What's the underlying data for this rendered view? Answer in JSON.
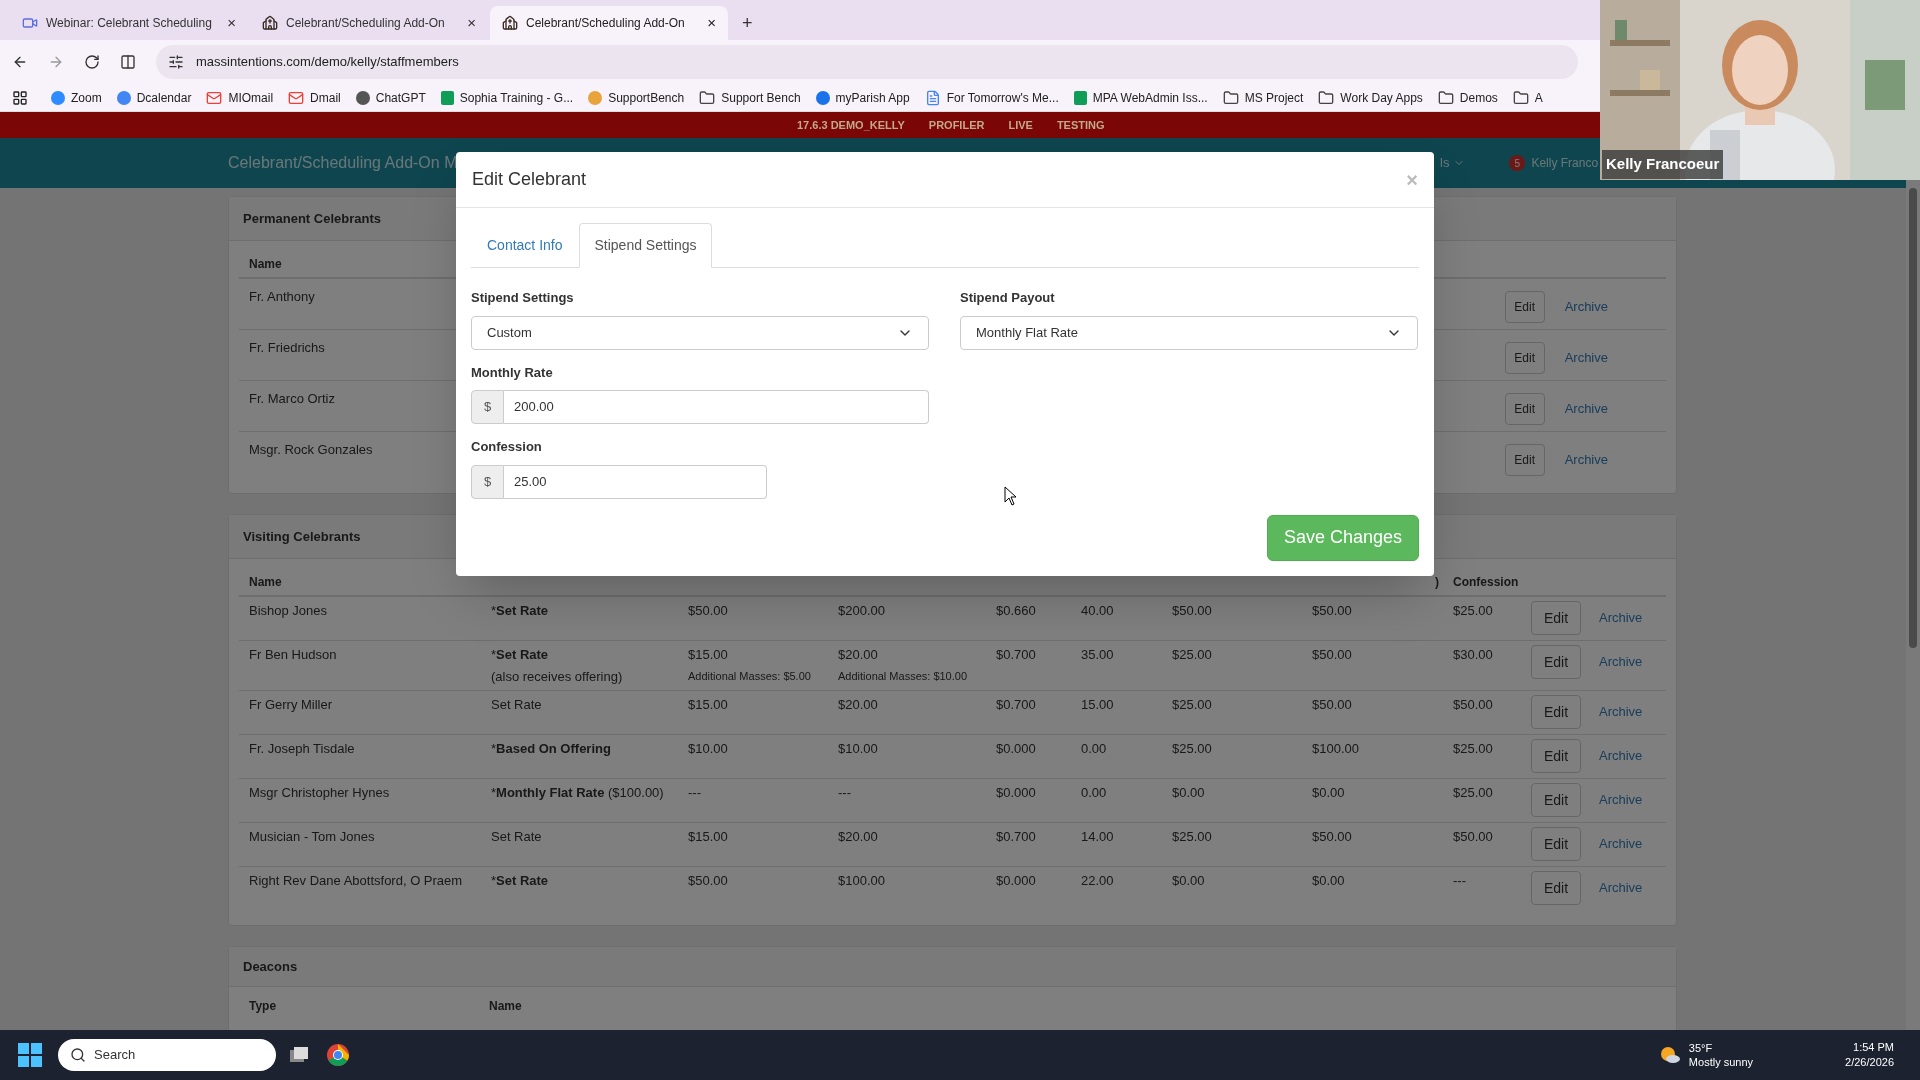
{
  "browser": {
    "tabs": [
      {
        "title": "Webinar: Celebrant Scheduling",
        "kind": "webinar",
        "selected": false
      },
      {
        "title": "Celebrant/Scheduling Add-On",
        "kind": "site",
        "selected": false
      },
      {
        "title": "Celebrant/Scheduling Add-On",
        "kind": "site",
        "selected": true
      }
    ],
    "new_tab": "+",
    "close": "×",
    "address": "massintentions.com/demo/kelly/staffmembers",
    "bookmarks": [
      {
        "label": "Zoom",
        "kind": "site",
        "color": "#2d8cff"
      },
      {
        "label": "Dcalendar",
        "kind": "site",
        "color": "#4285f4"
      },
      {
        "label": "MIOmail",
        "kind": "mail",
        "color": "#ea4335"
      },
      {
        "label": "Dmail",
        "kind": "mail",
        "color": "#ea4335"
      },
      {
        "label": "ChatGPT",
        "kind": "site",
        "color": "#555555"
      },
      {
        "label": "Sophia Training - G...",
        "kind": "sheet",
        "color": "#0f9d58"
      },
      {
        "label": "SupportBench",
        "kind": "site",
        "color": "#e8a33d"
      },
      {
        "label": "Support Bench",
        "kind": "folder"
      },
      {
        "label": "myParish App",
        "kind": "site",
        "color": "#1a73e8"
      },
      {
        "label": "For Tomorrow's Me...",
        "kind": "doc",
        "color": "#4285f4"
      },
      {
        "label": "MPA WebAdmin Iss...",
        "kind": "sheet",
        "color": "#0f9d58"
      },
      {
        "label": "MS Project",
        "kind": "folder"
      },
      {
        "label": "Work Day Apps",
        "kind": "folder"
      },
      {
        "label": "Demos",
        "kind": "folder"
      },
      {
        "label": "A",
        "kind": "folder"
      }
    ]
  },
  "env_bar": [
    "17.6.3 DEMO_KELLY",
    "PROFILER",
    "LIVE",
    "TESTING"
  ],
  "navbar": {
    "brand": "Celebrant/Scheduling Add-On M",
    "menu": "ls",
    "badge": "5",
    "user": "Kelly Franco"
  },
  "permanent": {
    "title": "Permanent Celebrants",
    "name_header": "Name",
    "rows": [
      {
        "name": "Fr. Anthony",
        "edit": "Edit",
        "archive": "Archive"
      },
      {
        "name": "Fr. Friedrichs",
        "edit": "Edit",
        "archive": "Archive"
      },
      {
        "name": "Fr. Marco Ortiz",
        "edit": "Edit",
        "archive": "Archive"
      },
      {
        "name": "Msgr. Rock Gonzales",
        "edit": "Edit",
        "archive": "Archive"
      }
    ]
  },
  "visiting": {
    "title": "Visiting Celebrants",
    "headers": {
      "name": "Name",
      "column_8": ")",
      "confession": "Confession"
    },
    "rows": [
      {
        "name": "Bishop Jones",
        "type": {
          "prefix": "*",
          "label": "Set Rate",
          "bold": true
        },
        "cells": [
          "$50.00",
          "$200.00",
          "$0.660",
          "40.00",
          "$50.00",
          "$50.00",
          "$25.00"
        ],
        "edit": "Edit",
        "archive": "Archive"
      },
      {
        "name": "Fr Ben Hudson",
        "type": {
          "prefix": "*",
          "label": "Set Rate",
          "bold": true,
          "note": "(also receives offering)"
        },
        "cells": [
          "$15.00",
          "$20.00",
          "$0.700",
          "35.00",
          "$25.00",
          "$50.00",
          "$30.00"
        ],
        "notes": [
          "Additional Masses: $5.00",
          "Additional Masses: $10.00"
        ],
        "edit": "Edit",
        "archive": "Archive"
      },
      {
        "name": "Fr Gerry Miller",
        "type": {
          "label": "Set Rate",
          "bold": false
        },
        "cells": [
          "$15.00",
          "$20.00",
          "$0.700",
          "15.00",
          "$25.00",
          "$50.00",
          "$50.00"
        ],
        "edit": "Edit",
        "archive": "Archive"
      },
      {
        "name": "Fr. Joseph Tisdale",
        "type": {
          "prefix": "*",
          "label": "Based On Offering",
          "bold": true
        },
        "cells": [
          "$10.00",
          "$10.00",
          "$0.000",
          "0.00",
          "$25.00",
          "$100.00",
          "$25.00"
        ],
        "edit": "Edit",
        "archive": "Archive"
      },
      {
        "name": "Msgr Christopher Hynes",
        "type": {
          "prefix": "*",
          "label": "Monthly Flat Rate",
          "bold": true,
          "suffix": "($100.00)"
        },
        "cells": [
          "---",
          "---",
          "$0.000",
          "0.00",
          "$0.00",
          "$0.00",
          "$25.00"
        ],
        "edit": "Edit",
        "archive": "Archive"
      },
      {
        "name": "Musician - Tom Jones",
        "type": {
          "label": "Set Rate",
          "bold": false
        },
        "cells": [
          "$15.00",
          "$20.00",
          "$0.700",
          "14.00",
          "$25.00",
          "$50.00",
          "$50.00"
        ],
        "edit": "Edit",
        "archive": "Archive"
      },
      {
        "name": "Right Rev Dane Abottsford, O Praem",
        "type": {
          "prefix": "*",
          "label": "Set Rate",
          "bold": true
        },
        "cells": [
          "$50.00",
          "$100.00",
          "$0.000",
          "22.00",
          "$0.00",
          "$0.00",
          "---"
        ],
        "edit": "Edit",
        "archive": "Archive"
      }
    ]
  },
  "deacons": {
    "title": "Deacons",
    "headers": [
      "Type",
      "Name"
    ]
  },
  "modal": {
    "title": "Edit Celebrant",
    "close": "×",
    "tabs": [
      {
        "label": "Contact Info",
        "selected": false
      },
      {
        "label": "Stipend Settings",
        "selected": true
      }
    ],
    "stipend_settings": {
      "label": "Stipend Settings",
      "value": "Custom"
    },
    "stipend_payout": {
      "label": "Stipend Payout",
      "value": "Monthly Flat Rate"
    },
    "monthly_rate": {
      "label": "Monthly Rate",
      "addon": "$",
      "value": "200.00"
    },
    "confession": {
      "label": "Confession",
      "addon": "$",
      "value": "25.00"
    },
    "save": "Save Changes"
  },
  "video": {
    "name": "Kelly Francoeur"
  },
  "taskbar": {
    "search": "Search",
    "temperature": "35°F",
    "weather": "Mostly sunny",
    "time": "1:54 PM",
    "date": "2/26/2026"
  }
}
